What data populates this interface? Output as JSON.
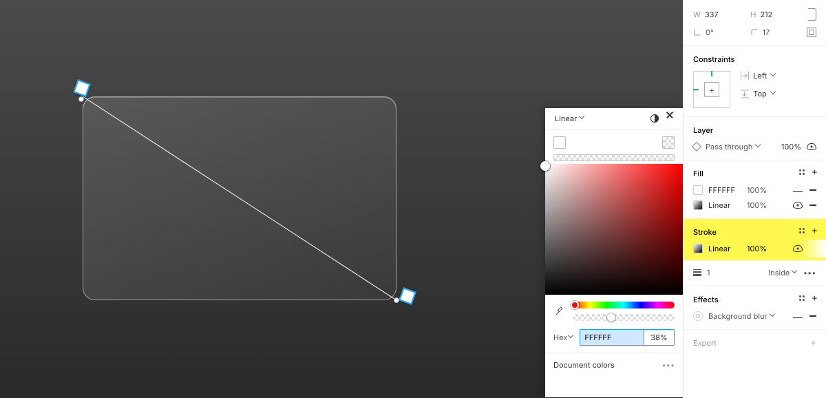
{
  "dims": {
    "w_label": "W",
    "w": "337",
    "h_label": "H",
    "h": "212",
    "angle_label": "0°",
    "corner": "17"
  },
  "popover": {
    "mode_label": "Linear",
    "hex_mode": "Hex",
    "hex_value": "FFFFFF",
    "opacity": "38%",
    "doc_colors": "Document colors"
  },
  "sections": {
    "constraints": {
      "title": "Constraints",
      "h": "Left",
      "v": "Top"
    },
    "layer": {
      "title": "Layer",
      "mode": "Pass through",
      "opacity": "100%"
    },
    "fill": {
      "title": "Fill",
      "items": [
        {
          "name": "FFFFFF",
          "pct": "100%",
          "hidden": true
        },
        {
          "name": "Linear",
          "pct": "100%",
          "hidden": false
        }
      ]
    },
    "stroke": {
      "title": "Stroke",
      "items": [
        {
          "name": "Linear",
          "pct": "100%",
          "hidden": false
        }
      ],
      "weight": "1",
      "align": "Inside"
    },
    "effects": {
      "title": "Effects",
      "items": [
        {
          "name": "Background blur",
          "hidden": true
        }
      ]
    },
    "export": {
      "title": "Export"
    }
  }
}
